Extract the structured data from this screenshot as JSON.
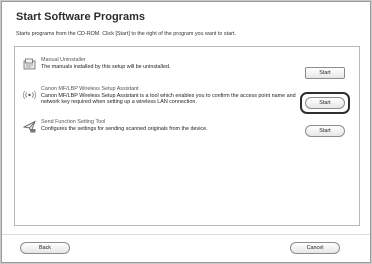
{
  "window": {
    "title": "Start Software Programs",
    "subtitle": "Starts programs from the CD-ROM. Click [Start] to the right of the program you want to start."
  },
  "programs": [
    {
      "title": "Manual Uninstaller",
      "description": "The manuals installed by this setup will be uninstalled.",
      "icon": "uninstaller-icon",
      "button_label": "Start"
    },
    {
      "title": "Canon MF/LBP Wireless Setup Assistant",
      "description": "Canon MF/LBP Wireless Setup Assistant is a tool which enables you to confirm the access point name and network key required when setting up a wireless LAN connection.",
      "icon": "wireless-icon",
      "button_label": "Start"
    },
    {
      "title": "Send Function Setting Tool",
      "description": "Configures the settings for sending scanned originals from the device.",
      "icon": "send-tool-icon",
      "button_label": "Start"
    }
  ],
  "footer": {
    "back_label": "Back",
    "cancel_label": "Cancel"
  },
  "colors": {
    "background": "#c9c9c9",
    "window": "#ffffff",
    "highlight_border": "#2f2f2f"
  }
}
